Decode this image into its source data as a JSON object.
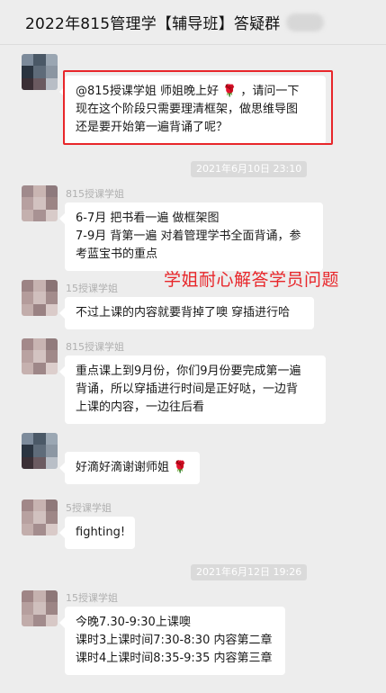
{
  "header": {
    "title": "2022年815管理学【辅导班】答疑群"
  },
  "overlay": {
    "caption": "学姐耐心解答学员问题"
  },
  "messages": [
    {
      "sender": "",
      "lines": [
        "@815授课学姐 师姐晚上好 🌹 ，请问一下",
        "现在这个阶段只需要理清框架，做思维导图",
        "还是要开始第一遍背诵了呢？"
      ]
    },
    {
      "sender": "815授课学姐",
      "lines": [
        "6-7月 把书看一遍 做框架图",
        "7-9月 背第一遍 对着管理学书全面背诵，参",
        "考蓝宝书的重点"
      ]
    },
    {
      "sender": "15授课学姐",
      "lines": [
        "不过上课的内容就要背掉了噢 穿插进行哈"
      ]
    },
    {
      "sender": "815授课学姐",
      "lines": [
        "重点课上到9月份，你们9月份要完成第一遍",
        "背诵，所以穿插进行时间是正好哒，一边背",
        "上课的内容，一边往后看"
      ]
    },
    {
      "sender": "",
      "lines": [
        "好滴好滴谢谢师姐 🌹"
      ]
    },
    {
      "sender": "5授课学姐",
      "lines": [
        "fighting!"
      ]
    },
    {
      "sender": "15授课学姐",
      "lines": [
        "今晚7.30-9:30上课噢",
        "课时3上课时间7:30-8:30 内容第二章",
        "课时4上课时间8:35-9:35 内容第三章"
      ]
    }
  ],
  "timestamps": [
    "2021年6月10日 23:10",
    "2021年6月12日 19:26"
  ],
  "colors": {
    "highlight": "#e8262a",
    "bubble": "#ffffff",
    "background": "#ededed"
  }
}
